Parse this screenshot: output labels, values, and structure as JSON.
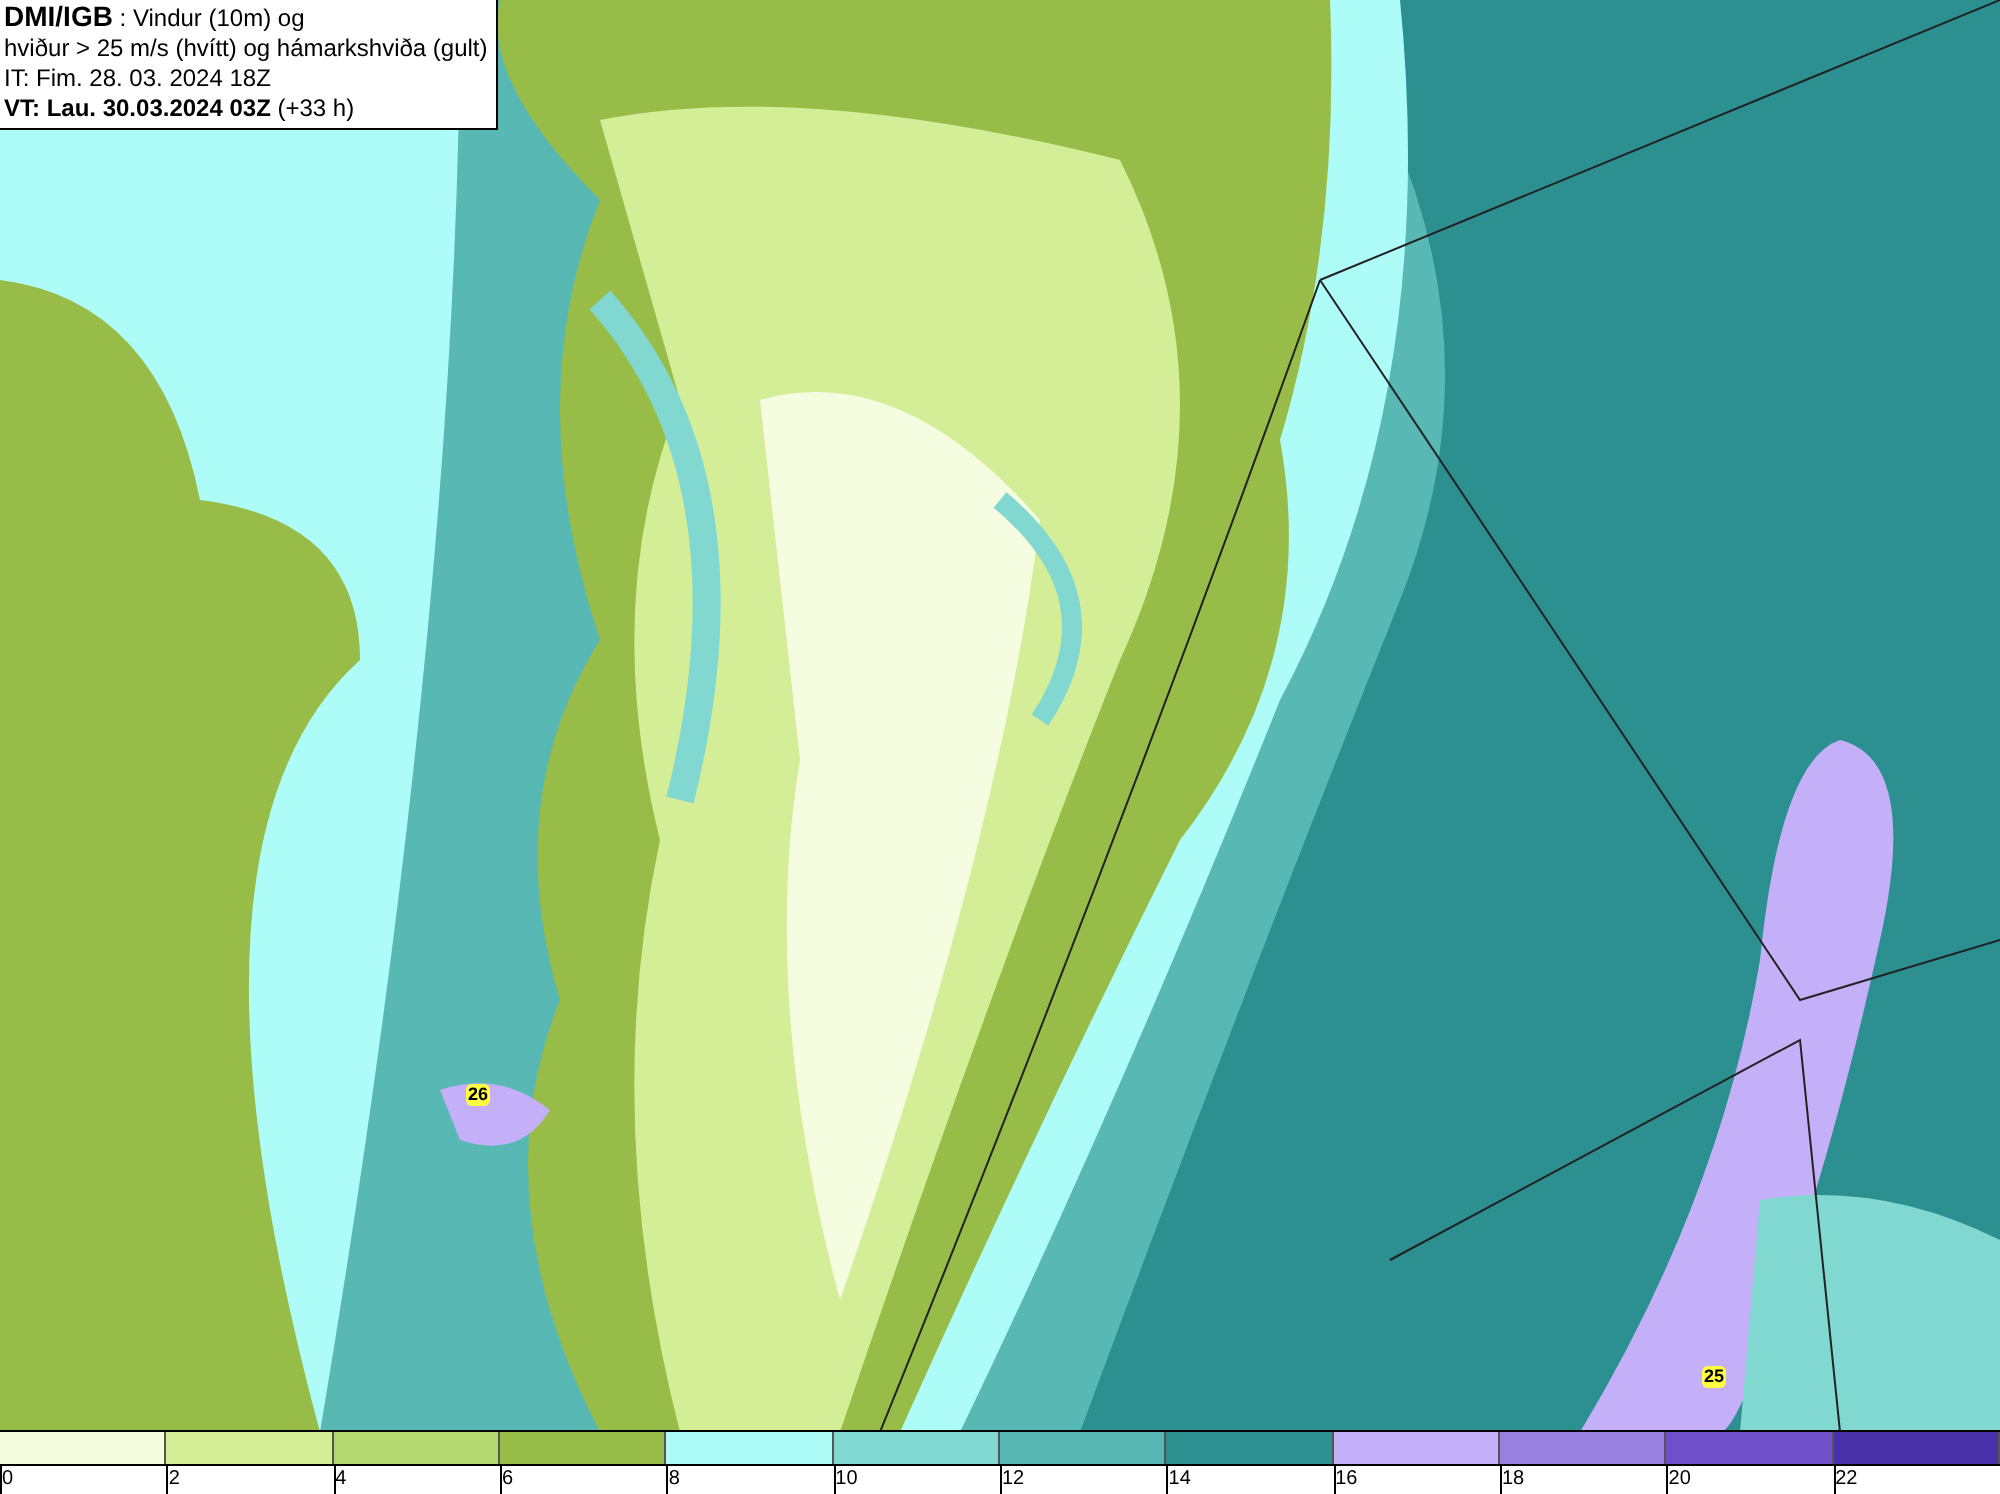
{
  "header": {
    "source": "DMI/IGB",
    "title_rest": " : Vindur (10m) og",
    "line2": "hviður > 25 m/s (hvítt) og hámarkshviða (gult)",
    "issue_time": "IT: Fim. 28. 03. 2024 18Z",
    "valid_time": "VT: Lau. 30.03.2024 03Z",
    "lead": " (+33 h)"
  },
  "map": {
    "gust_labels": [
      "26",
      "25"
    ]
  },
  "legend": {
    "segments": [
      {
        "color": "#f5fde0"
      },
      {
        "color": "#d4ee98"
      },
      {
        "color": "#b4d870"
      },
      {
        "color": "#98bc48"
      },
      {
        "color": "#aefcf8"
      },
      {
        "color": "#80d8d0"
      },
      {
        "color": "#58b8b4"
      },
      {
        "color": "#2c9090"
      },
      {
        "color": "#c4b0f8"
      },
      {
        "color": "#9880e0"
      },
      {
        "color": "#7050c8"
      },
      {
        "color": "#4830a8"
      }
    ],
    "ticks": [
      "0",
      "2",
      "4",
      "6",
      "8",
      "10",
      "12",
      "14",
      "16",
      "18",
      "20",
      "22"
    ]
  }
}
